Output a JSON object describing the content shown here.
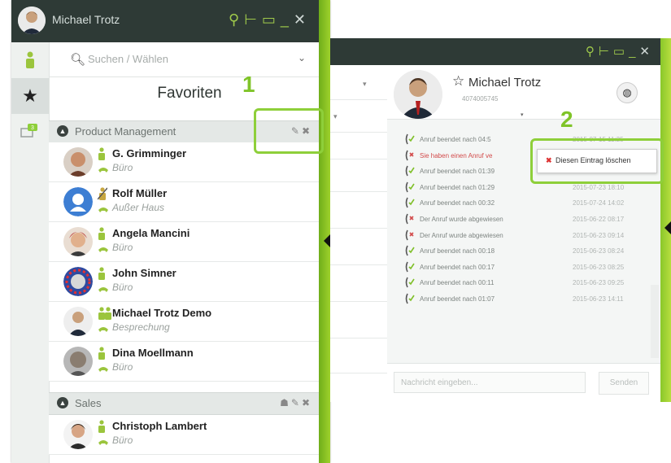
{
  "colors": {
    "accent": "#8ecf3a",
    "titlebar": "#2e3a36",
    "status_green": "#7fbf28",
    "missed_red": "#d24a4a"
  },
  "left_window": {
    "title": "Michael Trotz",
    "search_placeholder": "Suchen / Wählen",
    "favorites_title": "Favoriten",
    "groups": [
      {
        "name": "Product Management",
        "contacts": [
          {
            "name": "G. Grimminger",
            "status": "Büro"
          },
          {
            "name": "Rolf Müller",
            "status": "Außer Haus"
          },
          {
            "name": "Angela Mancini",
            "status": "Büro"
          },
          {
            "name": "John Simner",
            "status": "Büro"
          },
          {
            "name": "Michael Trotz Demo",
            "status": "Besprechung"
          },
          {
            "name": "Dina Moellmann",
            "status": "Büro"
          }
        ]
      },
      {
        "name": "Sales",
        "contacts": [
          {
            "name": "Christoph Lambert",
            "status": "Büro"
          }
        ]
      }
    ],
    "callout_number": "1"
  },
  "right_window": {
    "contact_name": "Michael Trotz",
    "contact_number": "4074005745",
    "calls": [
      {
        "text": "Anruf beendet nach 04:5",
        "date": "2015-07-15 11:25",
        "missed": false
      },
      {
        "text": "Sie haben einen Anruf ve",
        "date": "",
        "missed": true
      },
      {
        "text": "Anruf beendet nach 01:39",
        "date": "2015-07-23 18:14",
        "missed": false
      },
      {
        "text": "Anruf beendet nach 01:29",
        "date": "2015-07-23 18:10",
        "missed": false
      },
      {
        "text": "Anruf beendet nach 00:32",
        "date": "2015-07-24 14:02",
        "missed": false
      },
      {
        "text": "Der Anruf wurde abgewiesen",
        "date": "2015-06-22 08:17",
        "missed": true
      },
      {
        "text": "Der Anruf wurde abgewiesen",
        "date": "2015-06-23 09:14",
        "missed": true
      },
      {
        "text": "Anruf beendet nach 00:18",
        "date": "2015-06-23 08:24",
        "missed": false
      },
      {
        "text": "Anruf beendet nach 00:17",
        "date": "2015-06-23 08:25",
        "missed": false
      },
      {
        "text": "Anruf beendet nach 00:11",
        "date": "2015-06-23 09:25",
        "missed": false
      },
      {
        "text": "Anruf beendet nach 01:07",
        "date": "2015-06-23 14:11",
        "missed": false
      }
    ],
    "context_menu_item": "Diesen Eintrag löschen",
    "message_placeholder": "Nachricht eingeben...",
    "send_label": "Senden",
    "callout_number": "2"
  }
}
